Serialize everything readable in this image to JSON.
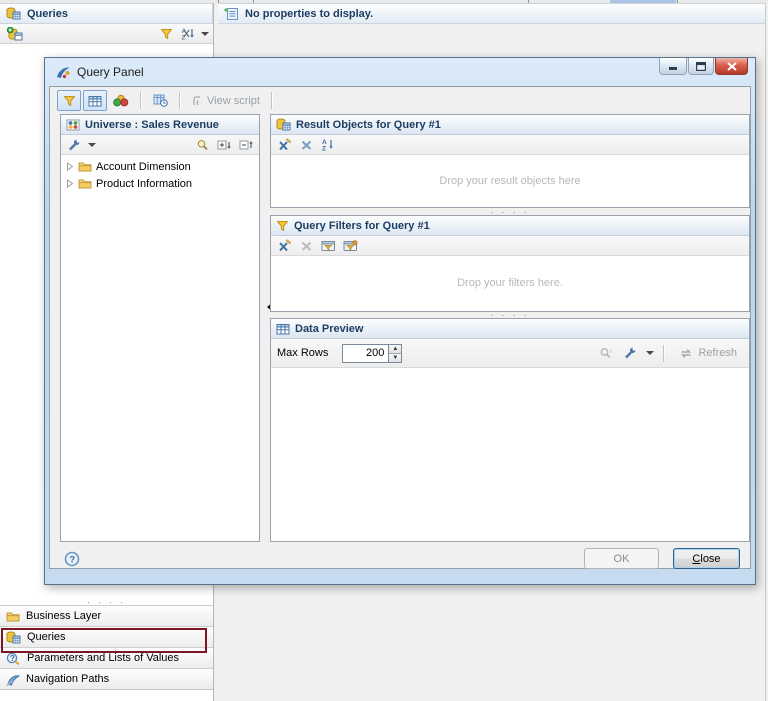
{
  "background": {
    "left_panel": {
      "title": "Queries",
      "toolbar": {
        "insert_query_icon": "insert-query",
        "filter_icon": "funnel",
        "sort_icon": "az-sort"
      },
      "sections": [
        {
          "label": "Business Layer",
          "icon": "folder"
        },
        {
          "label": "Queries",
          "icon": "query",
          "highlighted": true
        },
        {
          "label": "Parameters and Lists of Values",
          "icon": "parameter"
        },
        {
          "label": "Navigation Paths",
          "icon": "navigation-paths"
        }
      ]
    },
    "properties_panel": {
      "message": "No properties to display."
    }
  },
  "dialog": {
    "title": "Query Panel",
    "window_controls": [
      "minimize",
      "maximize",
      "close"
    ],
    "toolbar": {
      "view_script_label": "View script"
    },
    "universe_pane": {
      "title": "Universe : Sales Revenue",
      "tree": [
        {
          "label": "Account Dimension"
        },
        {
          "label": "Product Information"
        }
      ]
    },
    "result_objects": {
      "title": "Result Objects for Query #1",
      "drop_hint": "Drop your result objects here"
    },
    "query_filters": {
      "title": "Query Filters for Query #1",
      "drop_hint": "Drop your filters here."
    },
    "data_preview": {
      "title": "Data Preview",
      "max_rows_label": "Max Rows",
      "max_rows_value": "200",
      "refresh_label": "Refresh"
    },
    "footer": {
      "ok_label": "OK",
      "close_label_c": "C",
      "close_label_rest": "lose"
    }
  },
  "colors": {
    "header_text": "#1d3e63",
    "highlight_box": "#7c1627",
    "titlebar": "#c6daf0",
    "close_button": "#b53a29",
    "drop_hint_text": "#b8b8b8",
    "toggle_pressed_border": "#7da2ce"
  }
}
